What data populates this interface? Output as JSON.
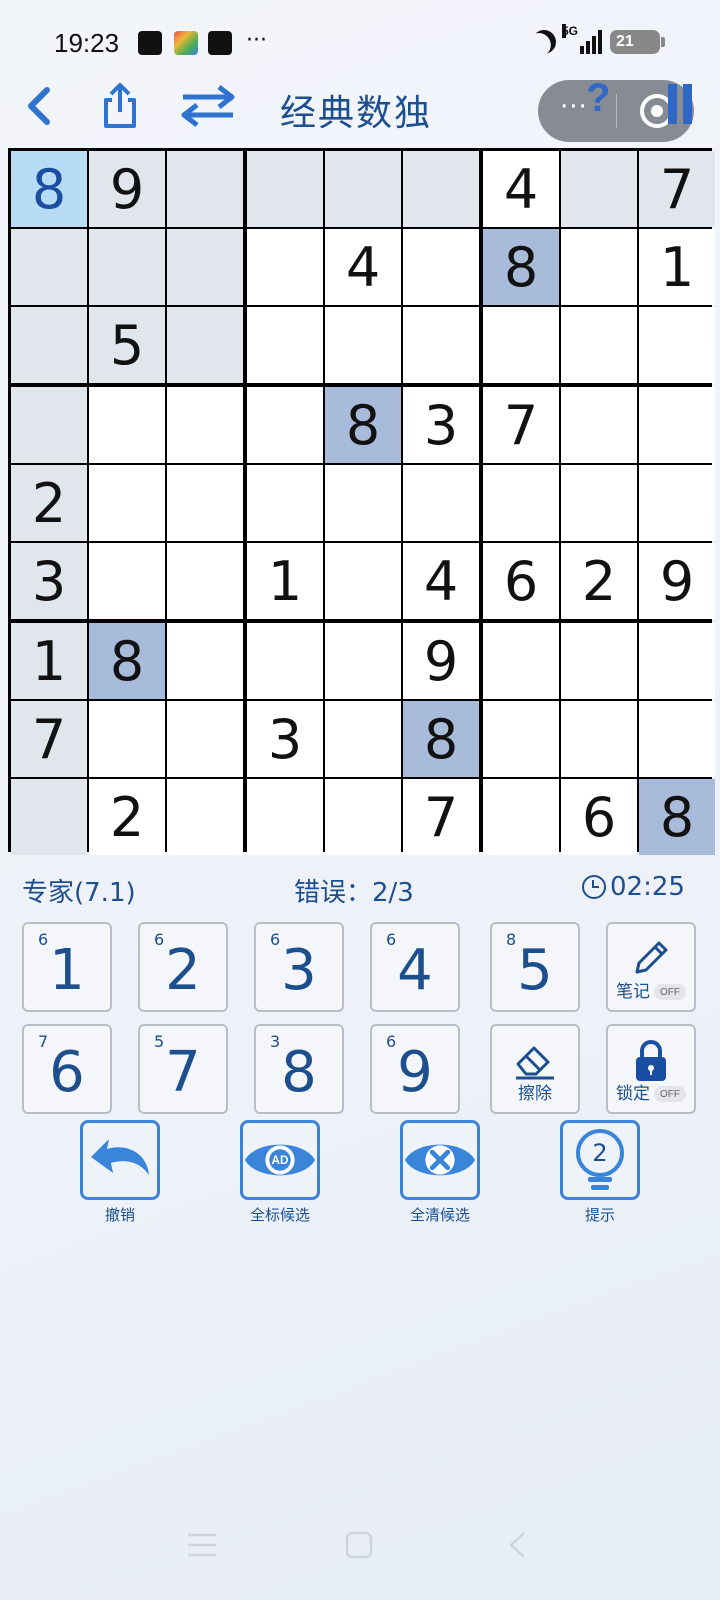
{
  "status_bar": {
    "time": "19:23",
    "more": "···",
    "network": "5G",
    "battery": "21",
    "icons": [
      "tiktok-app-icon",
      "colorful-app-icon",
      "video-app-icon",
      "moon-icon",
      "signal-icon",
      "battery-icon"
    ]
  },
  "header": {
    "title": "经典数独",
    "icons": [
      "back-chevron-icon",
      "share-icon",
      "swap-icon",
      "more-dots-icon",
      "help-icon",
      "pause-icon",
      "mini-program-close-icon"
    ],
    "capsule_more": "···",
    "help": "?"
  },
  "board": {
    "rows": [
      [
        "8",
        "9",
        "",
        "",
        "",
        "",
        "4",
        "",
        "7"
      ],
      [
        "",
        "",
        "",
        "",
        "4",
        "",
        "8",
        "",
        "1"
      ],
      [
        "",
        "5",
        "",
        "",
        "",
        "",
        "",
        "",
        ""
      ],
      [
        "",
        "",
        "",
        "",
        "8",
        "3",
        "7",
        "",
        ""
      ],
      [
        "2",
        "",
        "",
        "",
        "",
        "",
        "",
        "",
        ""
      ],
      [
        "3",
        "",
        "",
        "1",
        "",
        "4",
        "6",
        "2",
        "9"
      ],
      [
        "1",
        "8",
        "",
        "",
        "",
        "9",
        "",
        "",
        ""
      ],
      [
        "7",
        "",
        "",
        "3",
        "",
        "8",
        "",
        "",
        ""
      ],
      [
        "",
        "2",
        "",
        "",
        "",
        "7",
        "",
        "6",
        "8"
      ]
    ],
    "selected": [
      0,
      0
    ],
    "peer_cells": [
      [
        0,
        1
      ],
      [
        0,
        2
      ],
      [
        0,
        3
      ],
      [
        0,
        4
      ],
      [
        0,
        5
      ],
      [
        0,
        7
      ],
      [
        0,
        8
      ],
      [
        1,
        0
      ],
      [
        1,
        1
      ],
      [
        1,
        2
      ],
      [
        2,
        0
      ],
      [
        2,
        1
      ],
      [
        2,
        2
      ],
      [
        3,
        0
      ],
      [
        4,
        0
      ],
      [
        5,
        0
      ],
      [
        6,
        0
      ],
      [
        7,
        0
      ],
      [
        8,
        0
      ]
    ],
    "same_number_cells": [
      [
        1,
        6
      ],
      [
        3,
        4
      ],
      [
        6,
        1
      ],
      [
        7,
        5
      ],
      [
        8,
        8
      ]
    ],
    "colors": {
      "peer": "#e1e5ec",
      "same": "#a9bbdb",
      "selected": "#b9dcf6",
      "digit": "#111111",
      "selected_digit": "#1a4ea3"
    }
  },
  "info": {
    "difficulty": "专家(7.1)",
    "mistakes": "错误：2/3",
    "timer": "02:25"
  },
  "keypad": {
    "numbers": [
      {
        "digit": "1",
        "count": "6"
      },
      {
        "digit": "2",
        "count": "6"
      },
      {
        "digit": "3",
        "count": "6"
      },
      {
        "digit": "4",
        "count": "6"
      },
      {
        "digit": "5",
        "count": "8"
      },
      {
        "digit": "6",
        "count": "7"
      },
      {
        "digit": "7",
        "count": "5"
      },
      {
        "digit": "8",
        "count": "3"
      },
      {
        "digit": "9",
        "count": "6"
      }
    ],
    "notes": {
      "label": "笔记",
      "state": "OFF",
      "icon": "pencil-icon"
    },
    "erase": {
      "label": "擦除",
      "icon": "eraser-icon"
    },
    "lock": {
      "label": "锁定",
      "state": "OFF",
      "icon": "lock-icon"
    }
  },
  "actions": [
    {
      "label": "撤销",
      "icon": "undo-icon"
    },
    {
      "label": "全标候选",
      "icon": "eye-ad-icon",
      "badge": "AD"
    },
    {
      "label": "全清候选",
      "icon": "eye-clear-icon"
    },
    {
      "label": "提示",
      "icon": "lightbulb-icon",
      "badge": "2"
    }
  ],
  "accent_color": "#3a85d9",
  "text_color": "#1d4f8f",
  "navbar": {
    "icons": [
      "menu-icon",
      "home-square-icon",
      "back-triangle-icon"
    ]
  }
}
